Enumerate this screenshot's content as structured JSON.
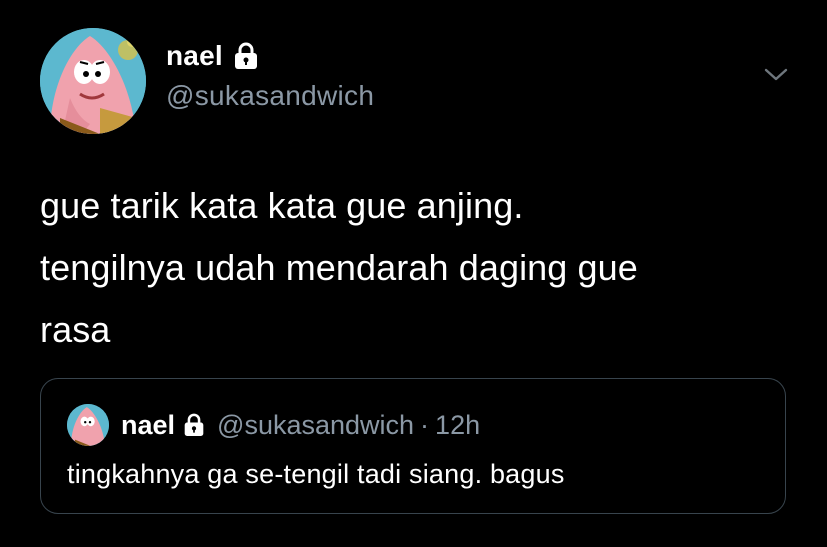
{
  "author": {
    "display_name": "nael",
    "handle": "@sukasandwich",
    "avatar_icon": "patrick-star-avatar",
    "protected_icon": "lock-icon"
  },
  "tweet": {
    "text": "gue tarik kata kata gue anjing.\ntengilnya udah mendarah daging gue\nrasa"
  },
  "quoted_tweet": {
    "display_name": "nael",
    "handle": "@sukasandwich",
    "separator": "·",
    "time": "12h",
    "text": "tingkahnya ga se-tengil tadi siang. bagus"
  },
  "menu": {
    "icon": "chevron-down-icon"
  },
  "colors": {
    "background": "#000000",
    "text_primary": "#ffffff",
    "text_secondary": "#8b98a5",
    "border": "#38444d"
  }
}
